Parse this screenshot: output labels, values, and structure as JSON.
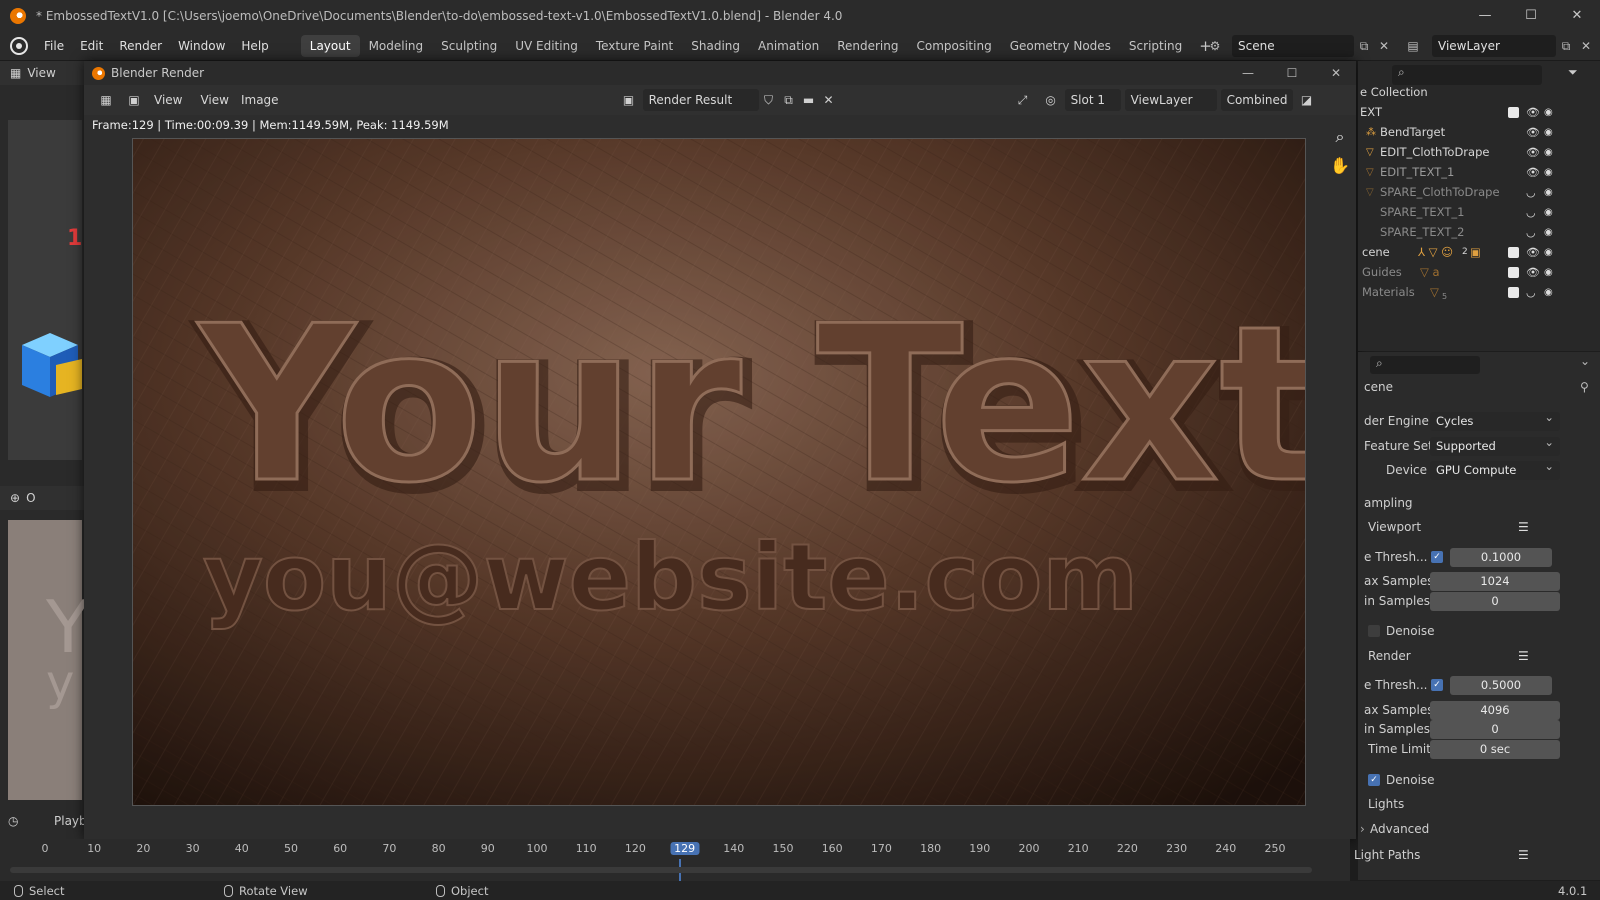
{
  "window": {
    "title": "* EmbossedTextV1.0 [C:\\Users\\joemo\\OneDrive\\Documents\\Blender\\to-do\\embossed-text-v1.0\\EmbossedTextV1.0.blend] - Blender 4.0",
    "minimize": "—",
    "maximize": "☐",
    "close": "✕"
  },
  "menubar": {
    "items": [
      "File",
      "Edit",
      "Render",
      "Window",
      "Help"
    ],
    "workspaces": [
      "Layout",
      "Modeling",
      "Sculpting",
      "UV Editing",
      "Texture Paint",
      "Shading",
      "Animation",
      "Rendering",
      "Compositing",
      "Geometry Nodes",
      "Scripting"
    ],
    "active_workspace": "Layout",
    "add": "+",
    "scene": "Scene",
    "view_layer": "ViewLayer"
  },
  "background_editor": {
    "header_label": "View",
    "header_label2": "Vi",
    "red_mark": "1",
    "obj_label": "O",
    "playback_label": "Playb",
    "letters": [
      "Y",
      "y"
    ]
  },
  "render_window": {
    "title": "Blender Render",
    "header": {
      "view1": "View",
      "view2": "View",
      "image": "Image",
      "image_name": "Render Result",
      "slot": "Slot 1",
      "view_layer": "ViewLayer",
      "pass": "Combined"
    },
    "stats": "Frame:129 | Time:00:09.39 | Mem:1149.59M, Peak: 1149.59M",
    "render_text_line1": "Your Text",
    "render_text_line2": "you@website.com"
  },
  "outliner": {
    "header": "e Collection",
    "rows": [
      {
        "label": "EXT",
        "checked": true,
        "visible": true
      },
      {
        "label": "BendTarget",
        "visible": true
      },
      {
        "label": "EDIT_ClothToDrape",
        "visible": true
      },
      {
        "label": "EDIT_TEXT_1",
        "visible": true
      },
      {
        "label": "SPARE_ClothToDrape",
        "visible": false
      },
      {
        "label": "SPARE_TEXT_1",
        "visible": false
      },
      {
        "label": "SPARE_TEXT_2",
        "visible": false
      },
      {
        "label": "cene",
        "checked": true,
        "visible": true
      },
      {
        "label": "Guides",
        "checked": true,
        "visible": true
      },
      {
        "label": "Materials",
        "checked": true,
        "visible": false
      }
    ],
    "badge_scene": "2",
    "badge_materials": "5"
  },
  "properties": {
    "context": "cene",
    "render_engine_label": "der Engine",
    "render_engine": "Cycles",
    "feature_set_label": "Feature Set",
    "feature_set": "Supported",
    "device_label": "Device",
    "device": "GPU Compute",
    "sampling_label": "ampling",
    "viewport_label": "Viewport",
    "viewport_noise_label": "e Thresh...",
    "viewport_noise": "0.1000",
    "viewport_max_label": "ax Samples",
    "viewport_max": "1024",
    "viewport_min_label": "in Samples",
    "viewport_min": "0",
    "viewport_denoise": "Denoise",
    "render_label": "Render",
    "render_noise_label": "e Thresh...",
    "render_noise": "0.5000",
    "render_max_label": "ax Samples",
    "render_max": "4096",
    "render_min_label": "in Samples",
    "render_min": "0",
    "time_limit_label": "Time Limit",
    "time_limit": "0 sec",
    "render_denoise": "Denoise",
    "lights": "Lights",
    "advanced": "Advanced",
    "light_paths": "Light Paths"
  },
  "timeline": {
    "ticks": [
      "0",
      "10",
      "20",
      "30",
      "40",
      "50",
      "60",
      "70",
      "80",
      "90",
      "100",
      "110",
      "120",
      "129",
      "140",
      "150",
      "160",
      "170",
      "180",
      "190",
      "200",
      "210",
      "220",
      "230",
      "240",
      "250"
    ],
    "current": "129"
  },
  "statusbar": {
    "select": "Select",
    "rotate": "Rotate View",
    "object": "Object",
    "version": "4.0.1"
  },
  "colors": {
    "accent": "#4772b3",
    "leather_dark": "#2e1a12",
    "leather_light": "#8a6450"
  }
}
